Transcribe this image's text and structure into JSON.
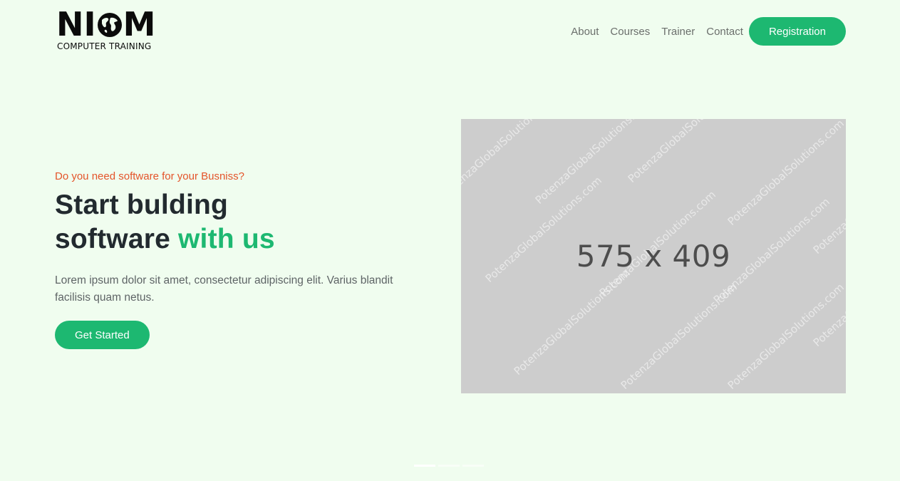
{
  "brand": {
    "logo_part1": "NI",
    "logo_part2": "M",
    "subtitle": "COMPUTER TRAINING",
    "icon": "globe-icon"
  },
  "nav": {
    "items": [
      {
        "label": "About"
      },
      {
        "label": "Courses"
      },
      {
        "label": "Trainer"
      },
      {
        "label": "Contact"
      }
    ],
    "cta_label": "Registration"
  },
  "hero": {
    "eyebrow": "Do you need software for your Busniss?",
    "headline_line1": "Start bulding",
    "headline_line2_plain": "software ",
    "headline_line2_accent": "with us",
    "lead": "Lorem ipsum dolor sit amet, consectetur adipiscing elit. Varius blandit facilisis quam netus.",
    "cta_label": "Get Started",
    "image_placeholder_label": "575 x 409",
    "watermark_text": "PotenzaGlobalSolutions.com"
  },
  "carousel": {
    "slide_count": 3,
    "active_index": 0
  },
  "colors": {
    "background": "#f0fdef",
    "accent": "#1db871",
    "eyebrow": "#e4542a",
    "heading": "#222a2f",
    "placeholder": "#cdcdcd"
  }
}
